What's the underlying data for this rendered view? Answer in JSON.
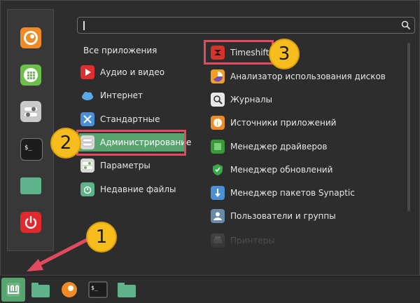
{
  "search": {
    "value": "",
    "placeholder": ""
  },
  "favorites": [
    {
      "icon": "firefox-icon"
    },
    {
      "icon": "calculator-icon"
    },
    {
      "icon": "settings-icon"
    },
    {
      "icon": "terminal-icon"
    },
    {
      "icon": "folder-icon"
    },
    {
      "icon": "power-icon"
    }
  ],
  "categories": {
    "header": "Все приложения",
    "items": [
      {
        "label": "Аудио и видео",
        "icon": "media-icon"
      },
      {
        "label": "Интернет",
        "icon": "cloud-icon"
      },
      {
        "label": "Стандартные",
        "icon": "tools-icon"
      },
      {
        "label": "Администрирование",
        "icon": "admin-icon",
        "selected": true
      },
      {
        "label": "Параметры",
        "icon": "preferences-icon"
      },
      {
        "label": "Недавние файлы",
        "icon": "recent-folder-icon"
      }
    ]
  },
  "apps": [
    {
      "label": "Timeshift",
      "icon": "timeshift-icon"
    },
    {
      "label": "Анализатор использования дисков",
      "icon": "disk-usage-icon"
    },
    {
      "label": "Журналы",
      "icon": "logs-icon"
    },
    {
      "label": "Источники приложений",
      "icon": "software-sources-icon"
    },
    {
      "label": "Менеджер драйверов",
      "icon": "driver-manager-icon"
    },
    {
      "label": "Менеджер обновлений",
      "icon": "update-manager-icon"
    },
    {
      "label": "Менеджер пакетов Synaptic",
      "icon": "synaptic-icon"
    },
    {
      "label": "Пользователи и группы",
      "icon": "users-icon"
    },
    {
      "label": "Принтеры",
      "icon": "printer-icon"
    }
  ],
  "annotations": {
    "step1": "1",
    "step2": "2",
    "step3": "3"
  },
  "taskbar": [
    {
      "icon": "mint-menu-icon"
    },
    {
      "icon": "folder-icon"
    },
    {
      "icon": "firefox-icon"
    },
    {
      "icon": "terminal-icon"
    },
    {
      "icon": "folder-icon"
    }
  ],
  "colors": {
    "accent_green": "#58a46f",
    "highlight_red": "#e24a5d",
    "badge_yellow": "#f7bd1c"
  }
}
